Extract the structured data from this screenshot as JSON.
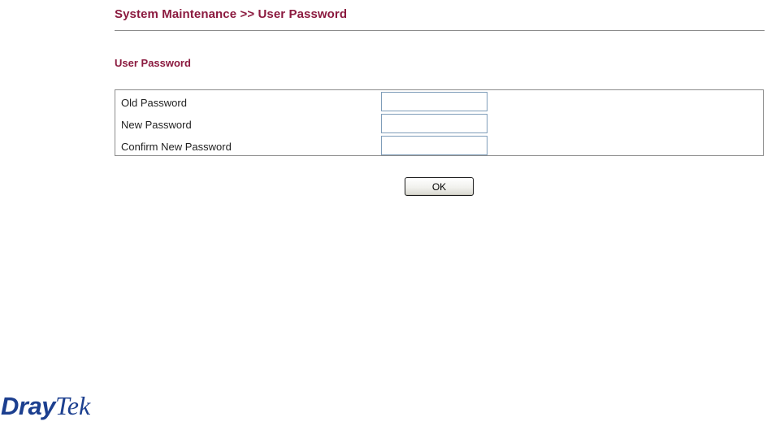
{
  "header": {
    "breadcrumb_title": "System Maintenance >> User Password"
  },
  "section": {
    "title": "User Password"
  },
  "form": {
    "fields": [
      {
        "label": "Old Password",
        "value": "",
        "placeholder": ""
      },
      {
        "label": "New Password",
        "value": "",
        "placeholder": ""
      },
      {
        "label": "Confirm New Password",
        "value": "",
        "placeholder": ""
      }
    ],
    "ok_label": "OK"
  },
  "branding": {
    "logo_part1": "Dray",
    "logo_part2": "Tek"
  },
  "colors": {
    "title": "#8b1a3f",
    "logo": "#1c3f8f",
    "border": "#8c8c8c"
  }
}
